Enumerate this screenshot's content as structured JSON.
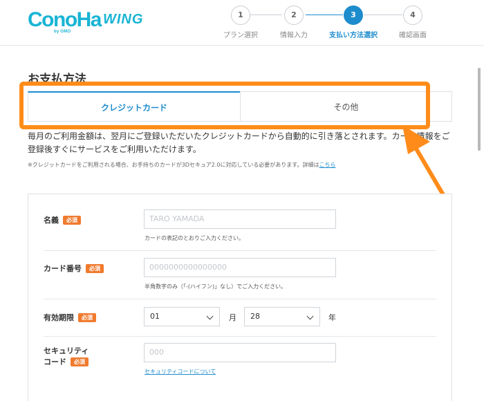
{
  "brand": {
    "logo_main": "ConoHa",
    "logo_sub": "by GMO",
    "logo_product": "WING",
    "color": "#19b4d4"
  },
  "steps": [
    {
      "number": "1",
      "label": "プラン選択"
    },
    {
      "number": "2",
      "label": "情報入力"
    },
    {
      "number": "3",
      "label": "支払い方法選択",
      "current": true
    },
    {
      "number": "4",
      "label": "確認画面"
    }
  ],
  "page": {
    "title": "お支払方法"
  },
  "tabs": [
    {
      "label": "クレジットカード",
      "active": true
    },
    {
      "label": "その他",
      "active": false
    }
  ],
  "description": "毎月のご利用金額は、翌月にご登録いただいたクレジットカードから自動的に引き落とされます。カード情報をご登録後すぐにサービスをご利用いただけます。",
  "note": {
    "text": "※クレジットカードをご利用される場合、お手持ちのカードが3Dセキュア2.0に対応している必要があります。詳細は",
    "link": "こちら"
  },
  "form": {
    "name": {
      "label": "名義",
      "required": "必須",
      "placeholder": "TARO YAMADA",
      "help": "カードの表記のとおりご入力ください。"
    },
    "card_number": {
      "label": "カード番号",
      "required": "必須",
      "placeholder": "0000000000000000",
      "help": "半角数字のみ（「-(ハイフン)」なし）でご入力ください。"
    },
    "expiry": {
      "label": "有効期限",
      "required": "必須",
      "month_value": "01",
      "month_unit": "月",
      "year_value": "28",
      "year_unit": "年"
    },
    "security": {
      "label_line1": "セキュリティ",
      "label_line2": "コード",
      "required": "必須",
      "placeholder": "000",
      "help_link": "セキュリティコードについて"
    }
  },
  "colors": {
    "accent": "#1d8ccd",
    "highlight": "#ff8c1a",
    "required_badge": "#f07a2e"
  }
}
